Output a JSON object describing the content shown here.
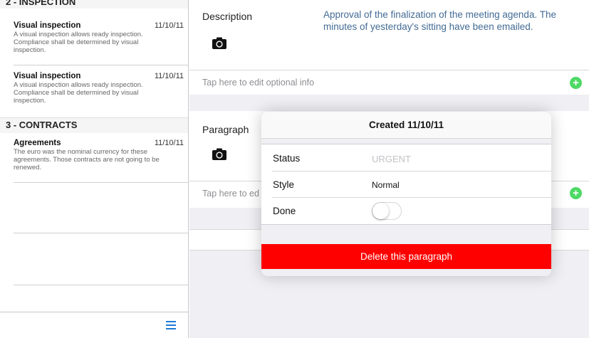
{
  "sidebar": {
    "sections": [
      {
        "title": "2 - INSPECTION",
        "items": [
          {
            "title": "Visual inspection",
            "date": "11/10/11",
            "description": "A visual inspection allows ready inspection. Compliance shall be determined by visual inspection."
          },
          {
            "title": "Visual inspection",
            "date": "11/10/11",
            "description": "A visual inspection allows ready inspection. Compliance shall be determined by visual inspection."
          }
        ]
      },
      {
        "title": "3 - CONTRACTS",
        "items": [
          {
            "title": "Agreements",
            "date": "11/10/11",
            "description": "The euro was the nominal currency for these agreements. Those contracts are not going to be renewed."
          }
        ]
      }
    ],
    "footer": {
      "menu_icon": "hamburger-menu-icon",
      "accent": "#1e7bd6"
    }
  },
  "main": {
    "description": {
      "label": "Description",
      "text": "Approval of the finalization of the meeting agenda. The minutes of yesterday's sitting have been emailed.",
      "camera_icon": "camera-icon",
      "optional_info": "Tap here to edit optional info"
    },
    "paragraph": {
      "label": "Paragraph",
      "camera_icon": "camera-icon",
      "optional_info": "Tap here to ed"
    },
    "add_button_icon": "plus-icon",
    "add_button_color": "#4cd964"
  },
  "popover": {
    "title": "Created 11/10/11",
    "rows": [
      {
        "label": "Status",
        "value": "URGENT"
      },
      {
        "label": "Style",
        "value": "Normal"
      },
      {
        "label": "Done",
        "toggle_on": false
      }
    ],
    "delete_label": "Delete this paragraph",
    "delete_color": "#ff0000"
  }
}
